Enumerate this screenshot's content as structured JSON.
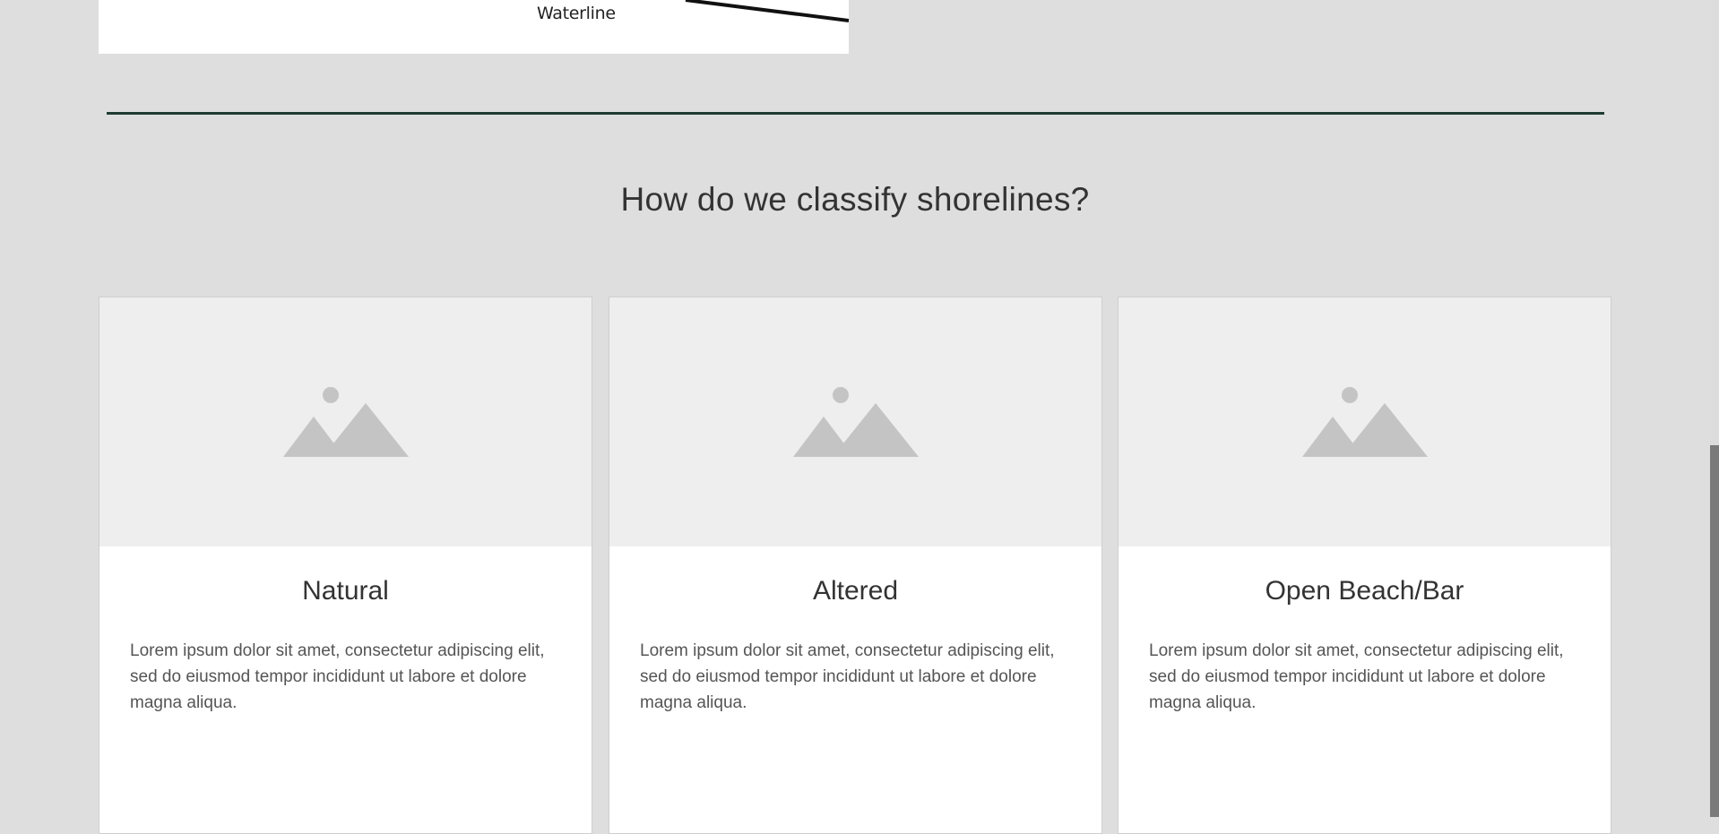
{
  "figure": {
    "label": "Waterline"
  },
  "section": {
    "title": "How do we classify shorelines?"
  },
  "cards": [
    {
      "title": "Natural",
      "text": "Lorem ipsum dolor sit amet, consectetur adipiscing elit, sed do eiusmod tempor incididunt ut labore et dolore magna aliqua.",
      "image_icon": "image-placeholder-icon"
    },
    {
      "title": "Altered",
      "text": "Lorem ipsum dolor sit amet, consectetur adipiscing elit, sed do eiusmod tempor incididunt ut labore et dolore magna aliqua.",
      "image_icon": "image-placeholder-icon"
    },
    {
      "title": "Open Beach/Bar",
      "text": "Lorem ipsum dolor sit amet, consectetur adipiscing elit, sed do eiusmod tempor incididunt ut labore et dolore magna aliqua.",
      "image_icon": "image-placeholder-icon"
    }
  ],
  "colors": {
    "page_background": "#dedede",
    "divider": "#1f3a32",
    "placeholder_background": "#eeeeee",
    "placeholder_icon": "#c4c4c4"
  }
}
